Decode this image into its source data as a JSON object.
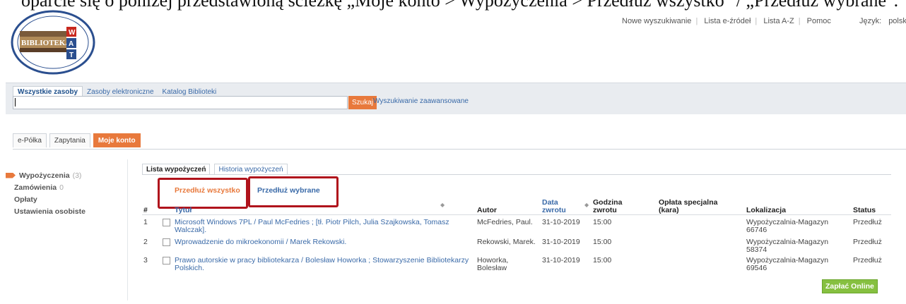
{
  "caption": "oparcie się o poniżej przedstawioną ścieżkę „Moje konto > Wypożyczenia > Przedłuż wszystko\" / „Przedłuż wybrane\".",
  "toplinks": [
    "Nowe wyszukiwanie",
    "Lista e-źródeł",
    "Lista A-Z",
    "Pomoc"
  ],
  "language": {
    "label": "Język:",
    "value": "polski"
  },
  "search": {
    "tabs": [
      "Wszystkie zasoby",
      "Zasoby elektroniczne",
      "Katalog Biblioteki"
    ],
    "button": "Szukaj",
    "advanced": "Wyszukiwanie zaawansowane"
  },
  "main_tabs": [
    "e-Półka",
    "Zapytania",
    "Moje konto"
  ],
  "sidebar": [
    {
      "label": "Wypożyczenia",
      "count": "(3)"
    },
    {
      "label": "Zamówienia",
      "count": "0"
    },
    {
      "label": "Opłaty",
      "count": ""
    },
    {
      "label": "Ustawienia osobiste",
      "count": ""
    }
  ],
  "panel_tabs": [
    "Lista wypożyczeń",
    "Historia wypożyczeń"
  ],
  "actions": {
    "renew_all": "Przedłuż wszystko",
    "renew_selected": "Przedłuż wybrane"
  },
  "columns": {
    "num": "#",
    "title": "Tytuł",
    "author": "Autor",
    "due_date": "Data zwrotu",
    "due_time": "Godzina zwrotu",
    "fee": "Opłata specjalna (kara)",
    "location": "Lokalizacja",
    "status": "Status"
  },
  "rows": [
    {
      "num": "1",
      "title": "Microsoft Windows 7PL / Paul McFedries ; [tł. Piotr Pilch, Julia Szajkowska, Tomasz Walczak].",
      "author": "McFedries, Paul.",
      "due_date": "31-10-2019",
      "due_time": "15:00",
      "location": "Wypożyczalnia-Magazyn 66746",
      "status": "Przedłuż"
    },
    {
      "num": "2",
      "title": "Wprowadzenie do mikroekonomii / Marek Rekowski.",
      "author": "Rekowski, Marek.",
      "due_date": "31-10-2019",
      "due_time": "15:00",
      "location": "Wypożyczalnia-Magazyn 58374",
      "status": "Przedłuż"
    },
    {
      "num": "3",
      "title": "Prawo autorskie w pracy bibliotekarza / Bolesław Howorka ; Stowarzyszenie Bibliotekarzy Polskich.",
      "author": "Howorka, Bolesław",
      "due_date": "31-10-2019",
      "due_time": "15:00",
      "location": "Wypożyczalnia-Magazyn 69546",
      "status": "Przedłuż"
    }
  ],
  "pay_button": "Zapłać Online",
  "logo_text": {
    "top": "BIBLIOTEKA GŁÓWNA",
    "main": "BIBLIOTEKA",
    "letters": [
      "W",
      "A",
      "T"
    ],
    "bottom": "Wojskowej Akademii Technicznej"
  }
}
